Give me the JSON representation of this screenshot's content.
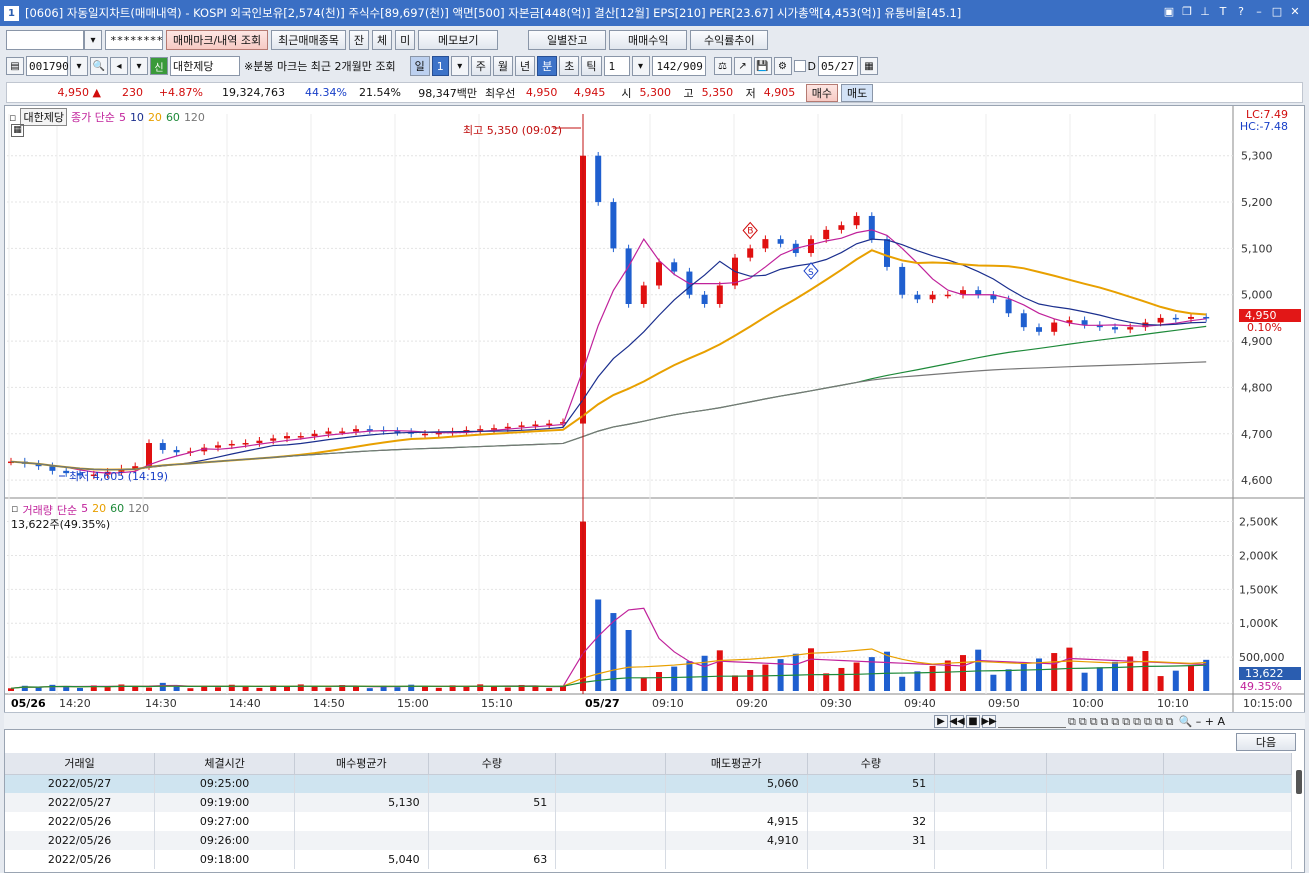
{
  "title": {
    "window_num": "1",
    "text": "[0606] 자동일지차트(매매내역) - KOSPI 외국인보유[2,574(천)] 주식수[89,697(천)] 액면[500] 자본금[448(억)] 결산[12월] EPS[210] PER[23.67] 시가총액[4,453(억)] 유통비율[45.1]"
  },
  "toolbar1": {
    "account_mask": "********",
    "btn_mark": "매매마크/내역 조회",
    "btn_recent": "최근매매종목",
    "btn_jan": "잔",
    "btn_che": "체",
    "btn_mi": "미",
    "btn_memo": "메모보기",
    "btn_daily": "일별잔고",
    "btn_profit": "매매수익",
    "btn_trend": "수익률추이"
  },
  "toolbar2": {
    "code": "001790",
    "sin": "신",
    "stock_name": "대한제당",
    "note": "※분봉 마크는 최근 2개월만 조회",
    "periods": [
      "일",
      "주",
      "월",
      "년",
      "분",
      "초",
      "틱"
    ],
    "day_num": "1",
    "interval": "1",
    "count": "142/909",
    "d_label": "D",
    "date": "05/27"
  },
  "quote": {
    "price": "4,950",
    "arrow": "▲",
    "change": "230",
    "pct": "+4.87%",
    "volume": "19,324,763",
    "ratio1": "44.34%",
    "ratio2": "21.54%",
    "amount": "98,347백만",
    "best_label": "최우선",
    "best_ask": "4,950",
    "best_bid": "4,945",
    "open_label": "시",
    "open": "5,300",
    "high_label": "고",
    "high": "5,350",
    "low_label": "저",
    "low": "4,905",
    "buy_btn": "매수",
    "sell_btn": "매도"
  },
  "chart": {
    "legend_name": "대한제당",
    "ma_label": "종가 단순",
    "ma_periods": [
      "5",
      "10",
      "20",
      "60",
      "120"
    ],
    "vol_label": "거래량",
    "vol_ma_label": "단순",
    "vol_ma_periods": [
      "5",
      "20",
      "60",
      "120"
    ],
    "vol_info": "13,622주(49.35%)",
    "max_label": "최고 5,350 (09:02)",
    "min_label": "최저 4,605 (14:19)",
    "lc": "LC:7.49",
    "hc": "HC:-7.48",
    "price_tag": "4,950",
    "pct_tag": "0.10%",
    "vol_tag": "13,622",
    "vol_pct_tag": "49.35%",
    "marker_b": "B",
    "marker_s": "S"
  },
  "chart_data": {
    "type": "candlestick",
    "price_axis": {
      "ticks": [
        4600,
        4700,
        4800,
        4900,
        5000,
        5100,
        5200,
        5300
      ],
      "labels": [
        "4,600",
        "4,700",
        "4,800",
        "4,900",
        "5,000",
        "5,100",
        "5,200",
        "5,300"
      ],
      "range": [
        4570,
        5390
      ]
    },
    "volume_axis": {
      "ticks": [
        500000,
        1000000,
        1500000,
        2000000,
        2500000
      ],
      "labels": [
        "500,000",
        "1,000K",
        "1,500K",
        "2,000K",
        "2,500K"
      ],
      "range": [
        0,
        2700000
      ]
    },
    "time_labels": [
      "05/26",
      "14:20",
      "14:30",
      "14:40",
      "14:50",
      "15:00",
      "15:10",
      "05/27",
      "09:10",
      "09:20",
      "09:30",
      "09:40",
      "09:50",
      "10:00",
      "10:10",
      "10:15:00"
    ],
    "close_path": [
      4640,
      4635,
      4630,
      4620,
      4615,
      4610,
      4612,
      4618,
      4625,
      4630,
      4680,
      4665,
      4660,
      4662,
      4670,
      4675,
      4678,
      4680,
      4685,
      4690,
      4695,
      4695,
      4700,
      4705,
      4705,
      4710,
      4708,
      4706,
      4704,
      4700,
      4700,
      4702,
      4705,
      4708,
      4710,
      4712,
      4715,
      4718,
      4720,
      4722,
      4725,
      5300,
      5200,
      5100,
      4980,
      5020,
      5070,
      5050,
      5000,
      4980,
      5020,
      5080,
      5100,
      5120,
      5110,
      5090,
      5120,
      5140,
      5150,
      5170,
      5120,
      5060,
      5000,
      4990,
      5000,
      5000,
      5010,
      5000,
      4990,
      4960,
      4930,
      4920,
      4940,
      4945,
      4935,
      4930,
      4925,
      4930,
      4940,
      4950,
      4948,
      4952,
      4950
    ]
  }
}
